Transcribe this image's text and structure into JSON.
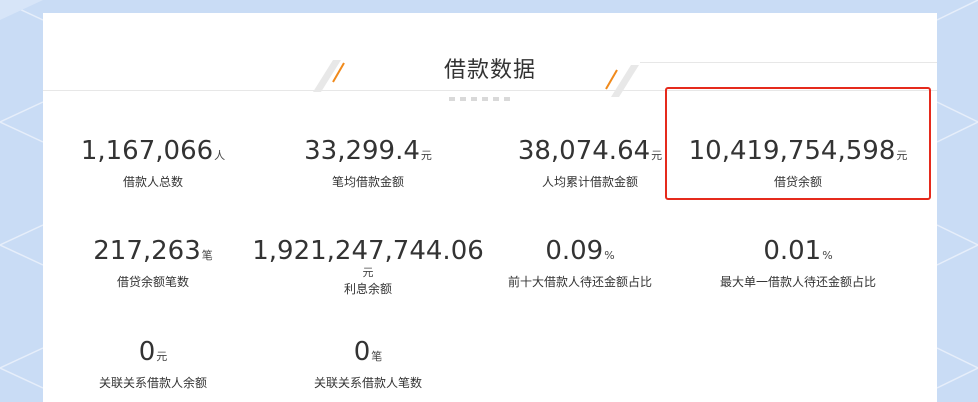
{
  "section": {
    "title": "借款数据"
  },
  "stats": [
    {
      "value": "1,167,066",
      "unit": "人",
      "label": "借款人总数"
    },
    {
      "value": "33,299.4",
      "unit": "元",
      "label": "笔均借款金额"
    },
    {
      "value": "38,074.64",
      "unit": "元",
      "label": "人均累计借款金额"
    },
    {
      "value": "10,419,754,598",
      "unit": "元",
      "label": "借贷余额"
    },
    {
      "value": "217,263",
      "unit": "笔",
      "label": "借贷余额笔数"
    },
    {
      "value": "1,921,247,744.06",
      "unit": "元",
      "label": "利息余额"
    },
    {
      "value": "0.09",
      "unit": "%",
      "label": "前十大借款人待还金额占比"
    },
    {
      "value": "0.01",
      "unit": "%",
      "label": "最大单一借款人待还金额占比"
    },
    {
      "value": "0",
      "unit": "元",
      "label": "关联关系借款人余额"
    },
    {
      "value": "0",
      "unit": "笔",
      "label": "关联关系借款人笔数"
    }
  ],
  "colors": {
    "highlight_border": "#e52a1c",
    "accent_orange": "#f08a1c",
    "background": "#c9dcf5"
  }
}
